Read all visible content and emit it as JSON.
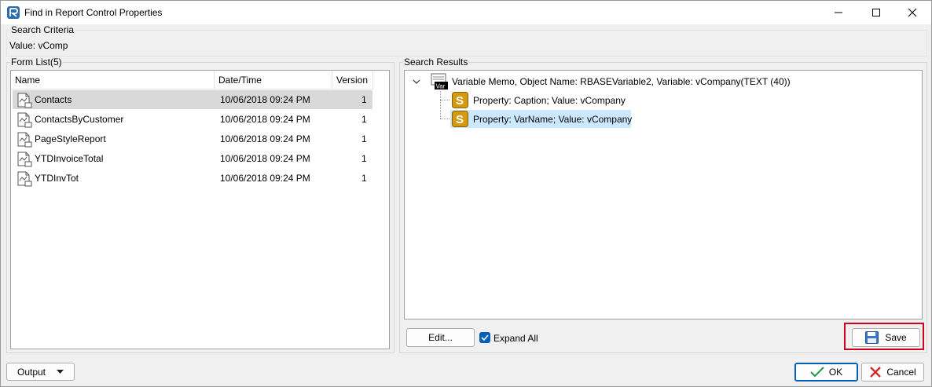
{
  "window": {
    "title": "Find in Report Control Properties"
  },
  "criteria": {
    "legend": "Search Criteria",
    "value_text": "Value: vComp"
  },
  "form_list": {
    "legend": "Form List(5)",
    "columns": [
      "Name",
      "Date/Time",
      "Version"
    ],
    "rows": [
      {
        "name": "Contacts",
        "datetime": "10/06/2018 09:24 PM",
        "version": "1"
      },
      {
        "name": "ContactsByCustomer",
        "datetime": "10/06/2018 09:24 PM",
        "version": "1"
      },
      {
        "name": "PageStyleReport",
        "datetime": "10/06/2018 09:24 PM",
        "version": "1"
      },
      {
        "name": "YTDInvoiceTotal",
        "datetime": "10/06/2018 09:24 PM",
        "version": "1"
      },
      {
        "name": "YTDInvTot",
        "datetime": "10/06/2018 09:24 PM",
        "version": "1"
      }
    ],
    "selected_index": 0
  },
  "results": {
    "legend": "Search Results",
    "root": {
      "label": "Variable Memo, Object Name: RBASEVariable2, Variable: vCompany(TEXT (40))",
      "icon_text": "Var"
    },
    "children": [
      {
        "label": "Property: Caption; Value: vCompany",
        "icon_text": "S"
      },
      {
        "label": "Property: VarName; Value: vCompany",
        "icon_text": "S"
      }
    ],
    "selected_child": 1
  },
  "buttons": {
    "edit": "Edit...",
    "expand_all": "Expand All",
    "save": "Save",
    "output": "Output",
    "ok": "OK",
    "cancel": "Cancel"
  },
  "colors": {
    "accent": "#005fb8",
    "highlight_box": "#d0021b",
    "selection": "#cce8ff",
    "row_selected": "#d9d9d9"
  }
}
